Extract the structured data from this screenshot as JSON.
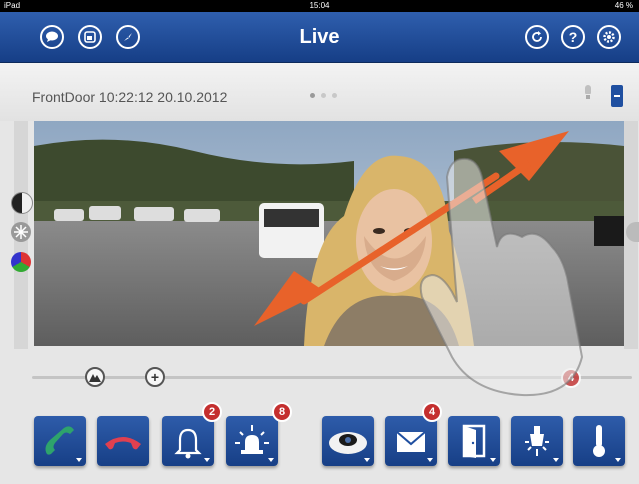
{
  "status": {
    "carrier": "iPad",
    "time": "15:04",
    "battery": "46 %"
  },
  "nav": {
    "title": "Live",
    "left_icons": [
      "chat-icon",
      "window-icon",
      "compass-icon"
    ],
    "right_icons": [
      "refresh-icon",
      "help-icon",
      "settings-icon"
    ],
    "help_label": "?"
  },
  "info": {
    "camera_label": "FrontDoor 10:22:12 20.10.2012",
    "page_dots": 3,
    "active_dot": 0
  },
  "toolbar": {
    "buttons": [
      {
        "name": "call-accept-button",
        "icon": "phone-green-icon",
        "badge": ""
      },
      {
        "name": "call-hangup-button",
        "icon": "phone-red-icon",
        "badge": ""
      },
      {
        "name": "bell-button",
        "icon": "bell-icon",
        "badge": "2"
      },
      {
        "name": "alarm-button",
        "icon": "alarm-light-icon",
        "badge": "8"
      },
      {
        "name": "camera-view-button",
        "icon": "hemispheric-camera-icon",
        "badge": ""
      },
      {
        "name": "messages-button",
        "icon": "envelope-icon",
        "badge": "4"
      },
      {
        "name": "door-open-button",
        "icon": "door-icon",
        "badge": ""
      },
      {
        "name": "light-button",
        "icon": "light-bulb-icon",
        "badge": ""
      },
      {
        "name": "temperature-button",
        "icon": "thermometer-icon",
        "badge": ""
      }
    ]
  },
  "slider": {
    "badge": "4"
  },
  "colors": {
    "accent": "#1f4fa0",
    "badge": "#c42f2f",
    "arrow": "#e8622a"
  }
}
